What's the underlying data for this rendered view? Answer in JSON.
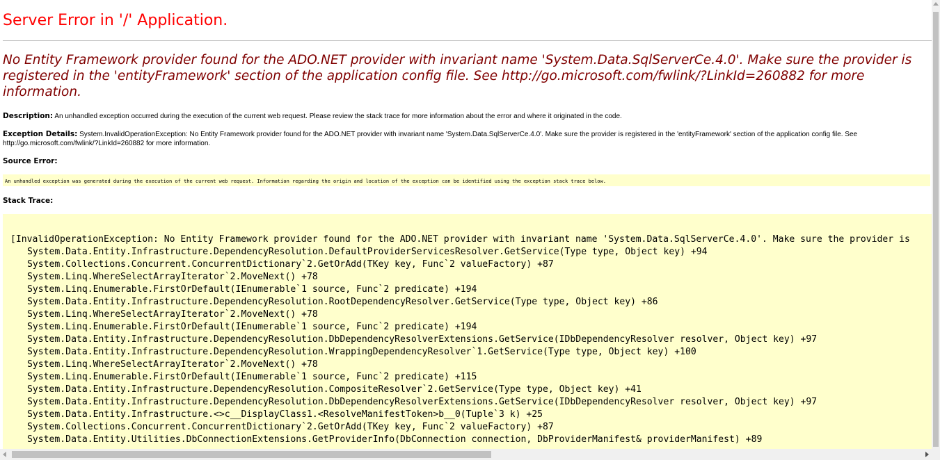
{
  "title": "Server Error in '/' Application.",
  "subtitle": "No Entity Framework provider found for the ADO.NET provider with invariant name 'System.Data.SqlServerCe.4.0'. Make sure the provider is registered in the 'entityFramework' section of the application config file. See http://go.microsoft.com/fwlink/?LinkId=260882 for more information.",
  "description": {
    "label": "Description:",
    "text": " An unhandled exception occurred during the execution of the current web request. Please review the stack trace for more information about the error and where it originated in the code."
  },
  "exception_details": {
    "label": "Exception Details:",
    "text": " System.InvalidOperationException: No Entity Framework provider found for the ADO.NET provider with invariant name 'System.Data.SqlServerCe.4.0'. Make sure the provider is registered in the 'entityFramework' section of the application config file. See http://go.microsoft.com/fwlink/?LinkId=260882 for more information."
  },
  "source_error": {
    "label": "Source Error:",
    "text": "An unhandled exception was generated during the execution of the current web request. Information regarding the origin and location of the exception can be identified using the exception stack trace below."
  },
  "stack_trace": {
    "label": "Stack Trace:",
    "lines": [
      "[InvalidOperationException: No Entity Framework provider found for the ADO.NET provider with invariant name 'System.Data.SqlServerCe.4.0'. Make sure the provider is",
      "System.Data.Entity.Infrastructure.DependencyResolution.DefaultProviderServicesResolver.GetService(Type type, Object key) +94",
      "System.Collections.Concurrent.ConcurrentDictionary`2.GetOrAdd(TKey key, Func`2 valueFactory) +87",
      "System.Linq.WhereSelectArrayIterator`2.MoveNext() +78",
      "System.Linq.Enumerable.FirstOrDefault(IEnumerable`1 source, Func`2 predicate) +194",
      "System.Data.Entity.Infrastructure.DependencyResolution.RootDependencyResolver.GetService(Type type, Object key) +86",
      "System.Linq.WhereSelectArrayIterator`2.MoveNext() +78",
      "System.Linq.Enumerable.FirstOrDefault(IEnumerable`1 source, Func`2 predicate) +194",
      "System.Data.Entity.Infrastructure.DependencyResolution.DbDependencyResolverExtensions.GetService(IDbDependencyResolver resolver, Object key) +97",
      "System.Data.Entity.Infrastructure.DependencyResolution.WrappingDependencyResolver`1.GetService(Type type, Object key) +100",
      "System.Linq.WhereSelectArrayIterator`2.MoveNext() +78",
      "System.Linq.Enumerable.FirstOrDefault(IEnumerable`1 source, Func`2 predicate) +115",
      "System.Data.Entity.Infrastructure.DependencyResolution.CompositeResolver`2.GetService(Type type, Object key) +41",
      "System.Data.Entity.Infrastructure.DependencyResolution.DbDependencyResolverExtensions.GetService(IDbDependencyResolver resolver, Object key) +97",
      "System.Data.Entity.Infrastructure.<>c__DisplayClass1.<ResolveManifestToken>b__0(Tuple`3 k) +25",
      "System.Collections.Concurrent.ConcurrentDictionary`2.GetOrAdd(TKey key, Func`2 valueFactory) +87",
      "System.Data.Entity.Utilities.DbConnectionExtensions.GetProviderInfo(DbConnection connection, DbProviderManifest& providerManifest) +89"
    ]
  },
  "icons": {
    "scroll_up": "arrow-up-icon",
    "scroll_left": "arrow-left-icon",
    "scroll_right": "arrow-right-icon"
  }
}
